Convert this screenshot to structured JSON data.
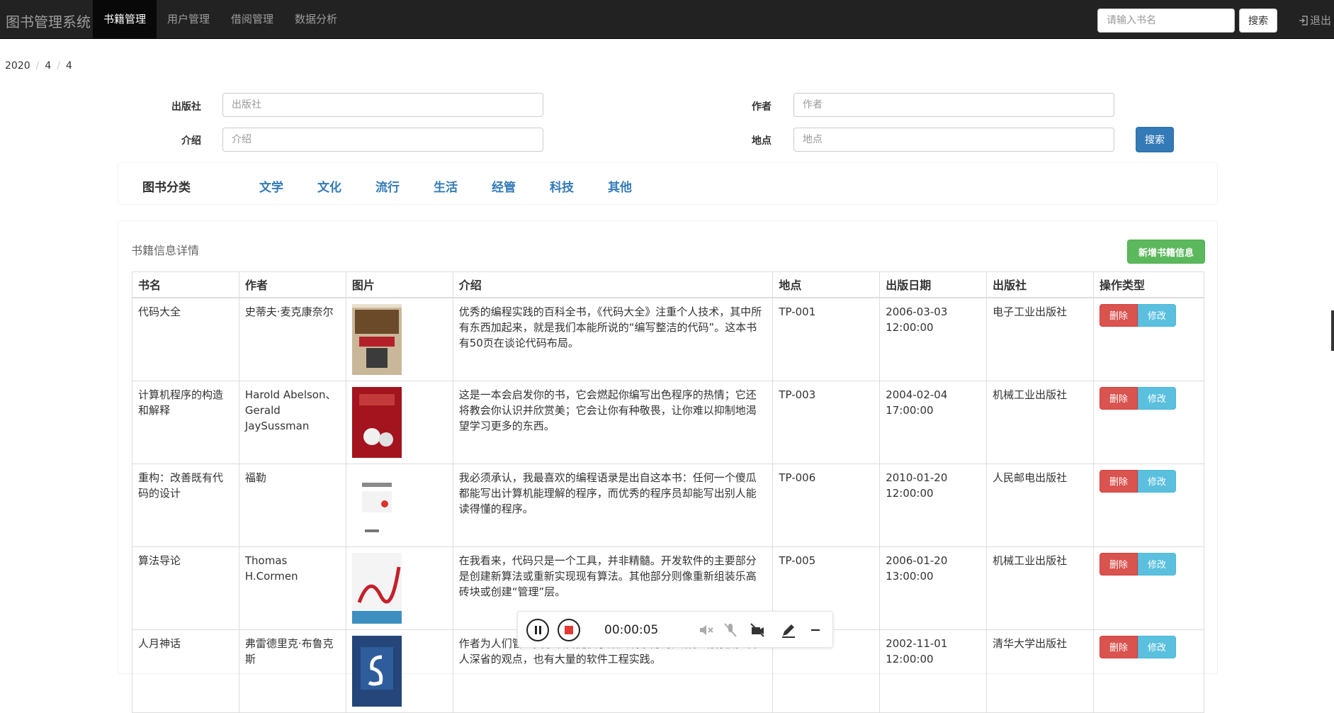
{
  "header": {
    "brand": "图书管理系统",
    "nav": [
      {
        "label": "书籍管理",
        "active": true
      },
      {
        "label": "用户管理",
        "active": false
      },
      {
        "label": "借阅管理",
        "active": false
      },
      {
        "label": "数据分析",
        "active": false
      }
    ],
    "search_placeholder": "请输入书名",
    "search_label": "搜索",
    "logout_label": "退出"
  },
  "breadcrumb": [
    "2020",
    "4",
    "4"
  ],
  "filter": {
    "publisher_label": "出版社",
    "publisher_placeholder": "出版社",
    "author_label": "作者",
    "author_placeholder": "作者",
    "intro_label": "介绍",
    "intro_placeholder": "介绍",
    "location_label": "地点",
    "location_placeholder": "地点",
    "search_label": "搜索"
  },
  "categories": {
    "title": "图书分类",
    "items": [
      "文学",
      "文化",
      "流行",
      "生活",
      "经管",
      "科技",
      "其他"
    ]
  },
  "details": {
    "title": "书籍信息详情",
    "add_label": "新增书籍信息",
    "columns": [
      "书名",
      "作者",
      "图片",
      "介绍",
      "地点",
      "出版日期",
      "出版社",
      "操作类型"
    ],
    "delete_label": "删除",
    "edit_label": "修改",
    "rows": [
      {
        "name": "代码大全",
        "author": "史蒂夫·麦克康奈尔",
        "intro": "优秀的编程实践的百科全书，《代码大全》注重个人技术，其中所有东西加起来，就是我们本能所说的“编写整洁的代码”。这本书有50页在谈论代码布局。",
        "location": "TP-001",
        "date": "2006-03-03 12:00:00",
        "publisher": "电子工业出版社"
      },
      {
        "name": "计算机程序的构造和解释",
        "author": "Harold Abelson、Gerald JaySussman",
        "intro": "这是一本会启发你的书，它会燃起你编写出色程序的热情；它还将教会你认识并欣赏美；它会让你有种敬畏，让你难以抑制地渴望学习更多的东西。",
        "location": "TP-003",
        "date": "2004-02-04 17:00:00",
        "publisher": "机械工业出版社"
      },
      {
        "name": "重构：改善既有代码的设计",
        "author": "福勒",
        "intro": "我必须承认，我最喜欢的编程语录是出自这本书：任何一个傻瓜都能写出计算机能理解的程序，而优秀的程序员却能写出别人能读得懂的程序。",
        "location": "TP-006",
        "date": "2010-01-20 12:00:00",
        "publisher": "人民邮电出版社"
      },
      {
        "name": "算法导论",
        "author": "Thomas H.Cormen",
        "intro": "在我看来，代码只是一个工具，并非精髓。开发软件的主要部分是创建新算法或重新实现现有算法。其他部分则像重新组装乐高砖块或创建“管理”层。",
        "location": "TP-005",
        "date": "2006-01-20 13:00:00",
        "publisher": "机械工业出版社"
      },
      {
        "name": "人月神话",
        "author": "弗雷德里克·布鲁克斯",
        "intro": "作者为人们管理复杂项目提供了颇具洞察力的见解，既有很多发人深省的观点，也有大量的软件工程实践。",
        "location": "TP-002",
        "date": "2002-11-01 12:00:00",
        "publisher": "清华大学出版社"
      }
    ]
  },
  "recorder": {
    "time": "00:00:05"
  }
}
